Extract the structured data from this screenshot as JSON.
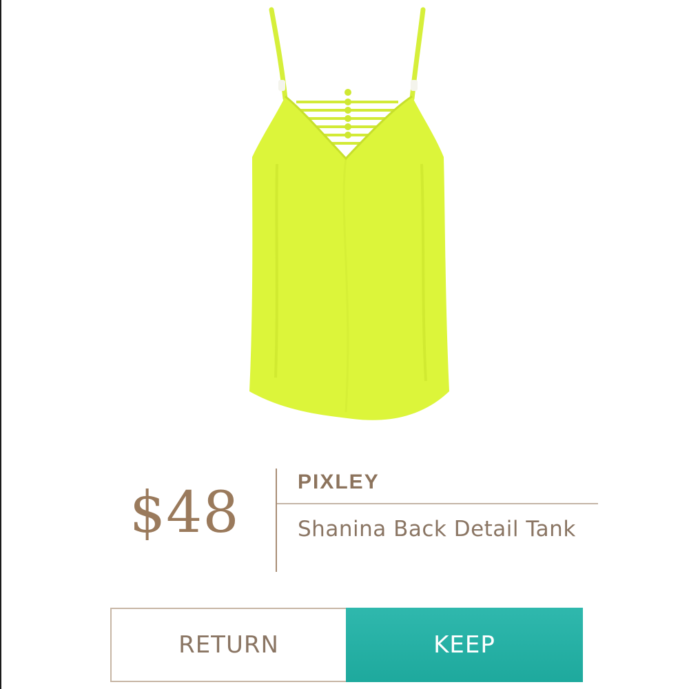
{
  "product": {
    "price": "$48",
    "brand": "PIXLEY",
    "name": "Shanina Back Detail Tank",
    "image_icon": "tank-top-image",
    "garment_color": "#dcf53a"
  },
  "actions": {
    "return_label": "RETURN",
    "keep_label": "KEEP",
    "keep_color": "#26b0a4",
    "text_accent": "#8a7563"
  }
}
